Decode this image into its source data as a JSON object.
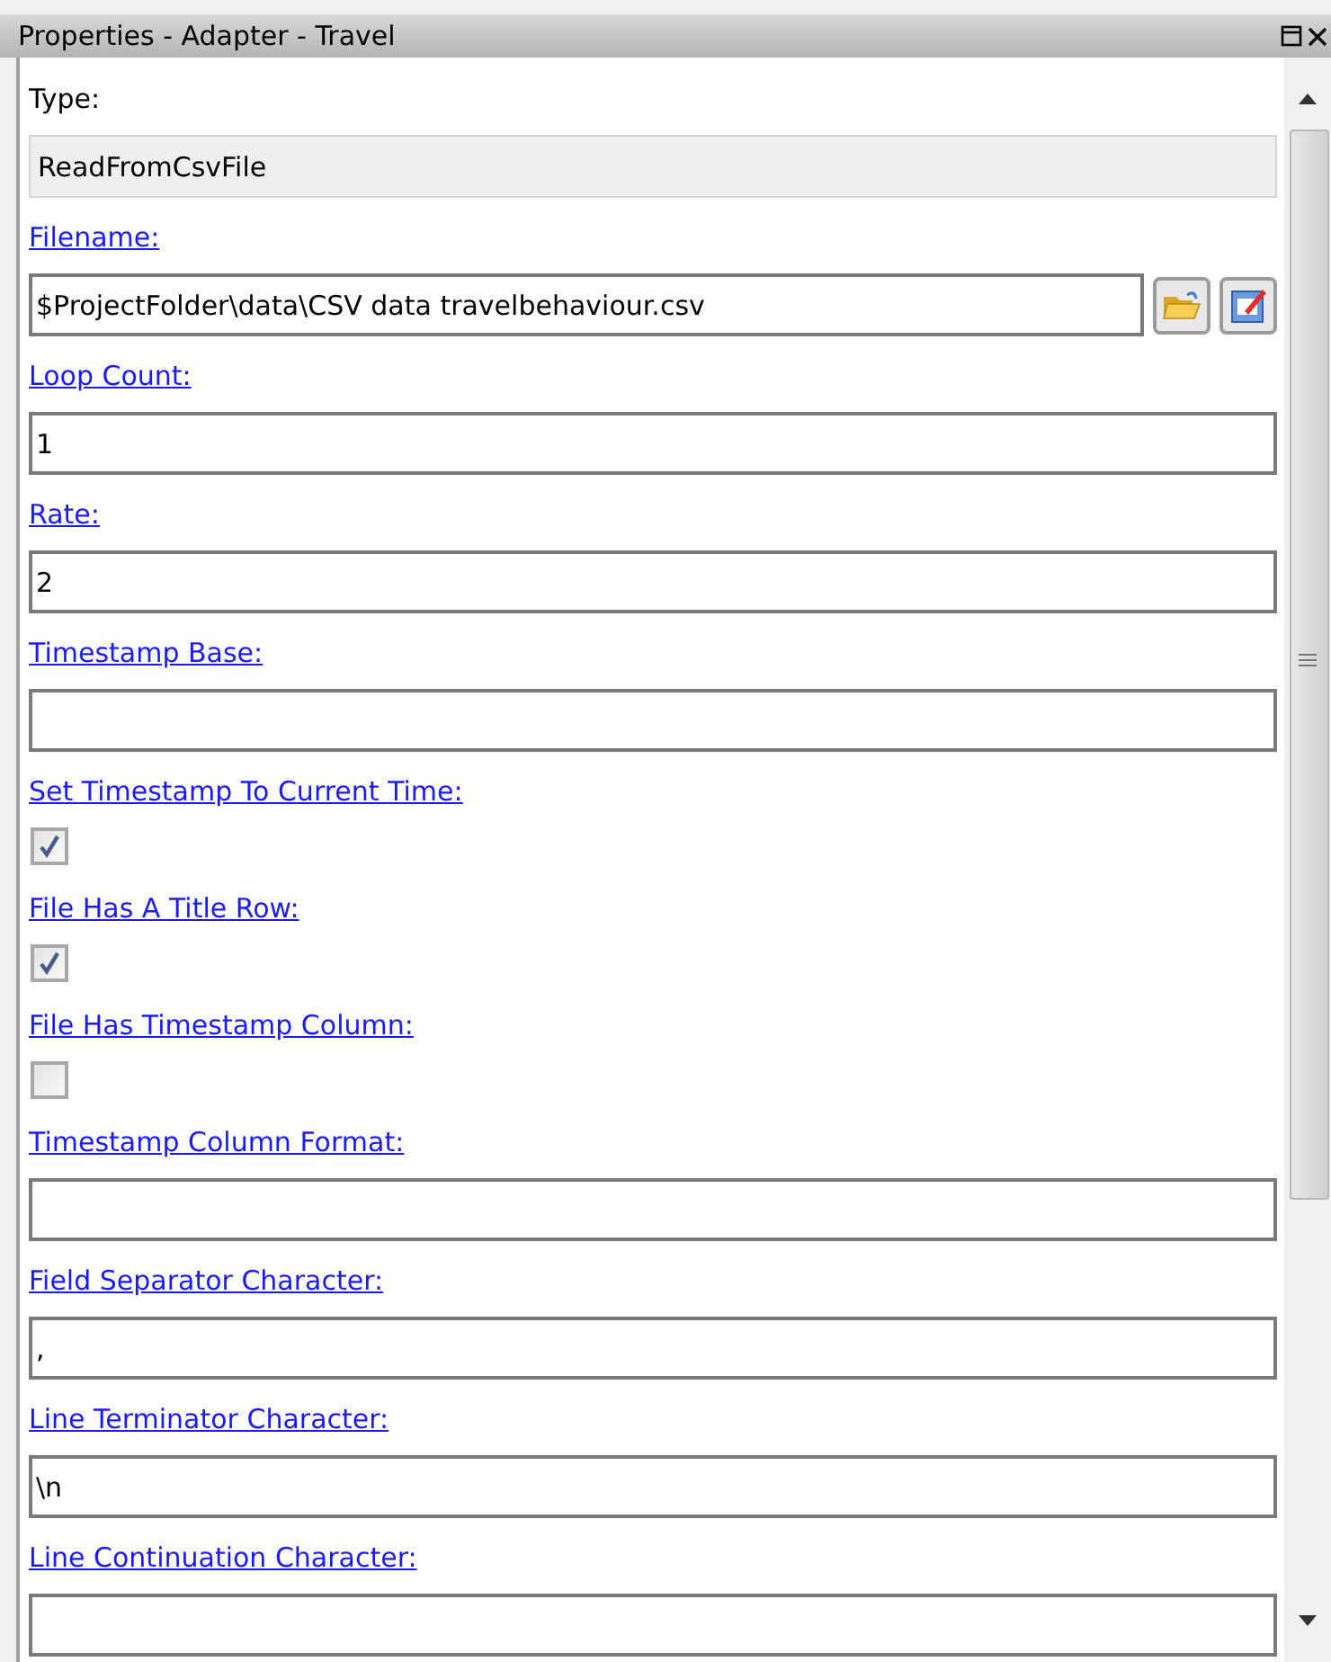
{
  "window": {
    "title": "Properties - Adapter - Travel"
  },
  "properties": [
    {
      "label": "Type:",
      "linked": false,
      "kind": "readonly",
      "value": "ReadFromCsvFile"
    },
    {
      "label": "Filename:",
      "linked": true,
      "kind": "file",
      "value": "$ProjectFolder\\data\\CSV data travelbehaviour.csv"
    },
    {
      "label": "Loop Count:",
      "linked": true,
      "kind": "text",
      "value": "1"
    },
    {
      "label": "Rate:",
      "linked": true,
      "kind": "text",
      "value": "2"
    },
    {
      "label": "Timestamp Base:",
      "linked": true,
      "kind": "text"
    },
    {
      "label": "Set Timestamp To Current Time:",
      "linked": true,
      "kind": "checkbox",
      "checked": true
    },
    {
      "label": "File Has A Title Row:",
      "linked": true,
      "kind": "checkbox",
      "checked": true
    },
    {
      "label": "File Has Timestamp Column:",
      "linked": true,
      "kind": "checkbox",
      "checked": false
    },
    {
      "label": "Timestamp Column Format:",
      "linked": true,
      "kind": "text"
    },
    {
      "label": "Field Separator Character:",
      "linked": true,
      "kind": "text",
      "value": ","
    },
    {
      "label": "Line Terminator Character:",
      "linked": true,
      "kind": "text",
      "value": "\\n"
    },
    {
      "label": "Line Continuation Character:",
      "linked": true,
      "kind": "text"
    }
  ]
}
